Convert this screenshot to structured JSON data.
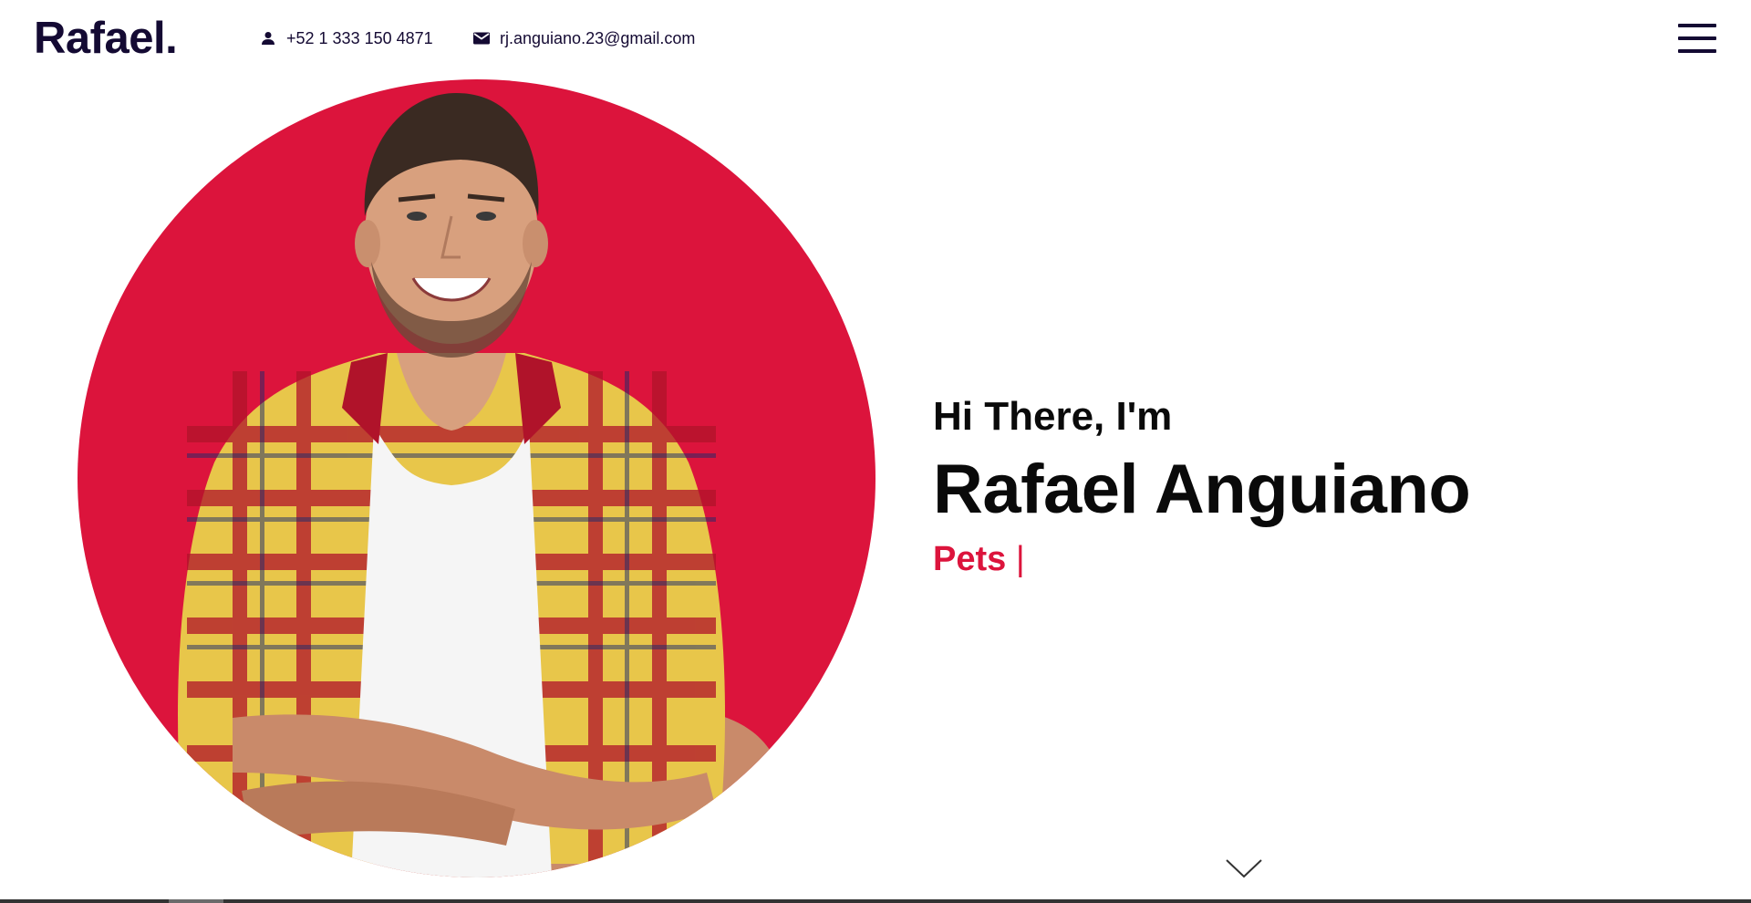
{
  "header": {
    "logo": "Rafael.",
    "phone": "+52 1 333 150 4871",
    "email": "rj.anguiano.23@gmail.com",
    "phone_icon": "person-icon",
    "email_icon": "mail-icon",
    "menu_icon": "hamburger-menu-icon"
  },
  "hero": {
    "greeting": "Hi There, I'm",
    "name": "Rafael Anguiano",
    "typed_role": "Pets",
    "cursor": "|",
    "photo": "portrait-photo",
    "scroll_icon": "chevron-down-icon"
  },
  "colors": {
    "accent": "#dc143c",
    "dark": "#140a33",
    "text": "#0a0a0a",
    "background": "#ffffff"
  }
}
